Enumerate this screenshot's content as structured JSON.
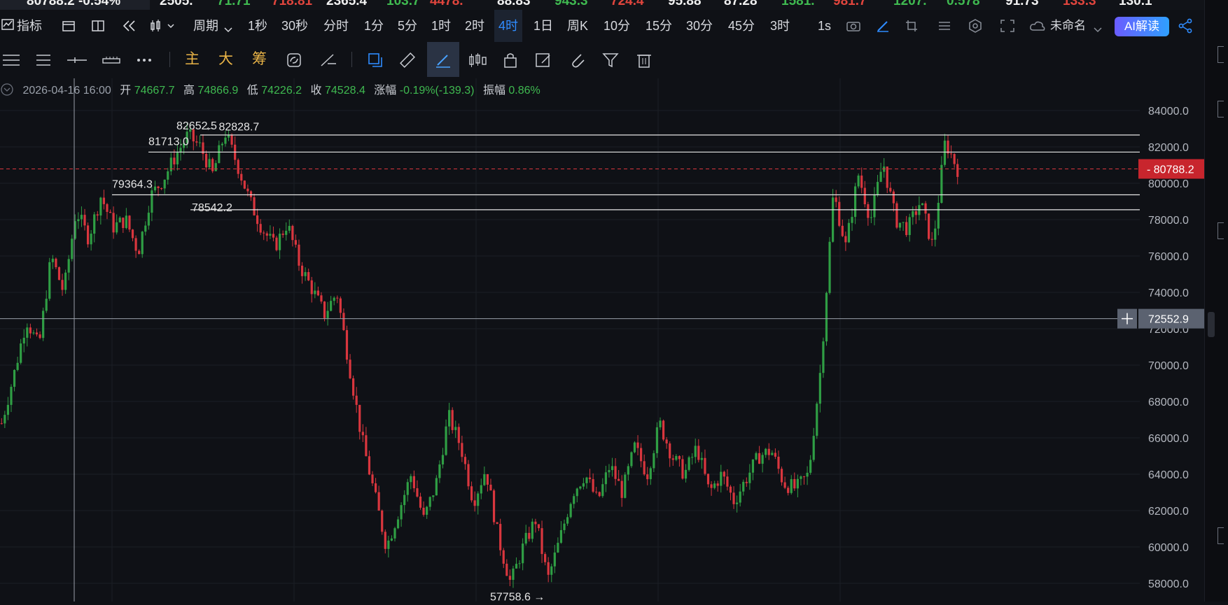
{
  "ticker": [
    {
      "text": "80788.2 -0.54%",
      "color": "#f0f0f0"
    },
    {
      "text": "2505.",
      "color": "#f0f0f0"
    },
    {
      "text": "71.71",
      "color": "#3fb950"
    },
    {
      "text": "718.81",
      "color": "#e0453d"
    },
    {
      "text": "2365.4",
      "color": "#f0f0f0"
    },
    {
      "text": "103.7",
      "color": "#3fb950"
    },
    {
      "text": "4478.",
      "color": "#e0453d"
    },
    {
      "text": "88.83",
      "color": "#f0f0f0"
    },
    {
      "text": "943.3",
      "color": "#3fb950"
    },
    {
      "text": "724.4",
      "color": "#e0453d"
    },
    {
      "text": "95.88",
      "color": "#f0f0f0"
    },
    {
      "text": "87.28",
      "color": "#f0f0f0"
    },
    {
      "text": "1581.",
      "color": "#3fb950"
    },
    {
      "text": "981.7",
      "color": "#e0453d"
    },
    {
      "text": "1207.",
      "color": "#3fb950"
    },
    {
      "text": "0.578",
      "color": "#3fb950"
    },
    {
      "text": "91.73",
      "color": "#f0f0f0"
    },
    {
      "text": "133.3",
      "color": "#e0453d"
    },
    {
      "text": "130.1",
      "color": "#f0f0f0"
    }
  ],
  "toolbar": {
    "indicator_label": "指标",
    "period_label": "周期",
    "periods": [
      "1秒",
      "30秒",
      "分时",
      "1分",
      "5分",
      "1时",
      "2时",
      "4时",
      "1日",
      "周K",
      "10分",
      "15分",
      "30分",
      "45分",
      "3时"
    ],
    "active_period": "4时",
    "interval_label": "1s",
    "layout_name": "未命名",
    "ai_label": "AI解读"
  },
  "drawbar": {
    "main_label": "主",
    "big_label": "大",
    "chip_label": "筹"
  },
  "info": {
    "datetime": "2026-04-16 16:00",
    "open_label": "开",
    "open": "74667.7",
    "high_label": "高",
    "high": "74866.9",
    "low_label": "低",
    "low": "74226.2",
    "close_label": "收",
    "close": "74528.4",
    "change_label": "涨幅",
    "change": "-0.19%(-139.3)",
    "amp_label": "振幅",
    "amp": "0.86%"
  },
  "chart_data": {
    "type": "candlestick",
    "ylim": [
      57000,
      85000
    ],
    "y_ticks": [
      "84000.0",
      "82000.0",
      "80000.0",
      "78000.0",
      "76000.0",
      "74000.0",
      "72000.0",
      "70000.0",
      "68000.0",
      "66000.0",
      "64000.0",
      "62000.0",
      "60000.0",
      "58000.0"
    ],
    "last_price": "80788.2",
    "crosshair_price": "72552.9",
    "horizontal_lines": [
      82652.5,
      81713.0,
      79364.3,
      78542.2
    ],
    "annotations": [
      {
        "text": "82652.5",
        "price": 82652.5
      },
      {
        "text": "81713.0",
        "price": 81713.0
      },
      {
        "text": "← 82828.7",
        "price": 82828.7
      },
      {
        "text": "79364.3",
        "price": 79364.3
      },
      {
        "text": "78542.2",
        "price": 78542.2
      },
      {
        "text": "57758.6 →",
        "price": 57758.6
      }
    ],
    "path_prices": [
      66800,
      69500,
      72500,
      71000,
      76000,
      74000,
      78500,
      77000,
      79300,
      77600,
      78000,
      76200,
      79300,
      80200,
      81500,
      82650,
      82000,
      80500,
      82800,
      81000,
      79000,
      77500,
      76500,
      77800,
      75500,
      74200,
      72800,
      74000,
      70000,
      66000,
      63000,
      60000,
      62000,
      64000,
      61500,
      63500,
      67200,
      65500,
      62500,
      64300,
      60500,
      58000,
      60000,
      61500,
      58200,
      60500,
      63000,
      64000,
      62500,
      64500,
      63000,
      65500,
      64000,
      66800,
      65000,
      64000,
      65500,
      63000,
      64000,
      62500,
      63800,
      65000,
      65300,
      63500,
      63200,
      64000,
      70000,
      79500,
      76500,
      80500,
      78000,
      81200,
      78000,
      77500,
      79000,
      76500,
      82300,
      80788
    ]
  }
}
